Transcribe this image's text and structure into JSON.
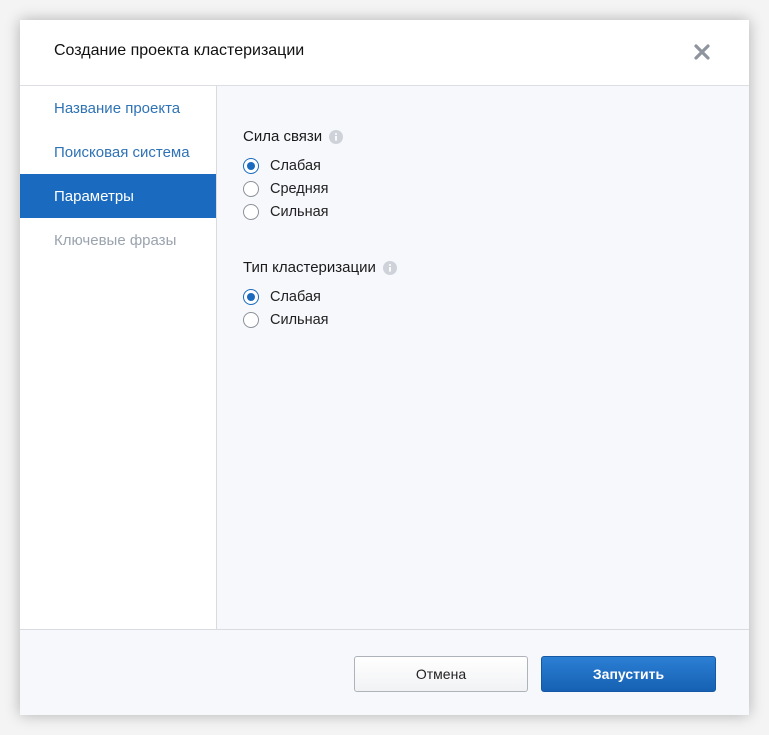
{
  "dialog": {
    "title": "Создание проекта кластеризации",
    "close_icon": "close-icon"
  },
  "sidebar": {
    "items": [
      {
        "label": "Название проекта",
        "state": "link"
      },
      {
        "label": "Поисковая система",
        "state": "link"
      },
      {
        "label": "Параметры",
        "state": "active"
      },
      {
        "label": "Ключевые фразы",
        "state": "disabled"
      }
    ]
  },
  "params": {
    "link_strength": {
      "title": "Сила связи",
      "info_icon": "info-icon",
      "options": [
        {
          "label": "Слабая",
          "checked": true
        },
        {
          "label": "Средняя",
          "checked": false
        },
        {
          "label": "Сильная",
          "checked": false
        }
      ]
    },
    "clustering_type": {
      "title": "Тип кластеризации",
      "info_icon": "info-icon",
      "options": [
        {
          "label": "Слабая",
          "checked": true
        },
        {
          "label": "Сильная",
          "checked": false
        }
      ]
    }
  },
  "footer": {
    "cancel_label": "Отмена",
    "run_label": "Запустить"
  },
  "colors": {
    "accent": "#1a6bbf",
    "link": "#2f73b6",
    "disabled": "#9aa3ae"
  }
}
